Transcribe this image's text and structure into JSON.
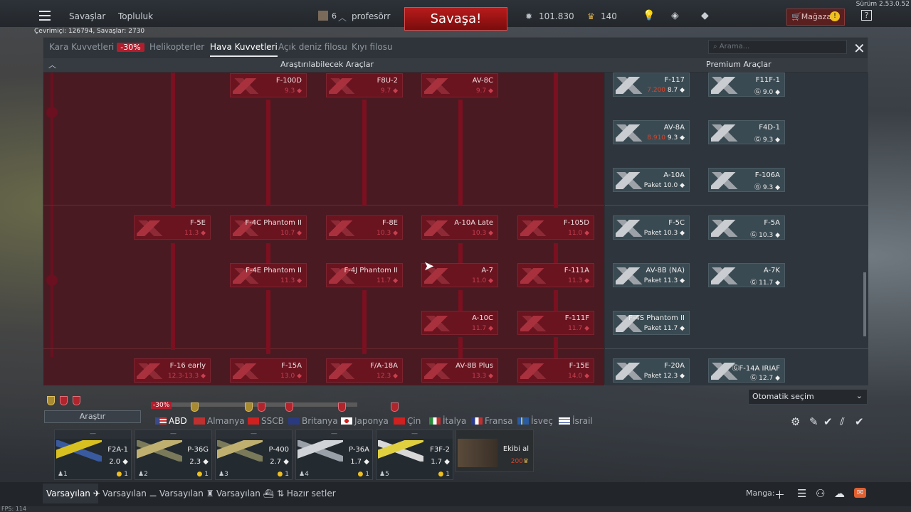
{
  "version": "Sürüm 2.53.0.52",
  "online": "Çevrimiçi: 126794, Savaşlar: 2730",
  "topbar": {
    "battles": "Savaşlar",
    "community": "Topluluk",
    "squad_count": "6",
    "player": "profesörr",
    "battle_button": "Savaşa!",
    "silver": "101.830",
    "gold": "140",
    "shop": "Mağaza"
  },
  "tabs": {
    "ground": "Kara Kuvvetleri",
    "ground_sale": "-30%",
    "heli": "Helikopterler",
    "air": "Hava Kuvvetleri",
    "bluewater": "Açık deniz filosu",
    "coastal": "Kıyı filosu"
  },
  "search": {
    "placeholder": "Arama..."
  },
  "headers": {
    "research": "Araştırılabilecek Araçlar",
    "premium": "Premium Araçlar"
  },
  "tree": [
    {
      "name": "F-100D",
      "br": "9.3 ◆"
    },
    {
      "name": "F8U-2",
      "br": "9.7 ◆"
    },
    {
      "name": "AV-8C",
      "br": "9.7 ◆"
    },
    {
      "name": "F-5E",
      "br": "11.3 ◆"
    },
    {
      "name": "F-4C Phantom II",
      "br": "10.7 ◆"
    },
    {
      "name": "F-8E",
      "br": "10.3 ◆"
    },
    {
      "name": "A-10A Late",
      "br": "10.3 ◆"
    },
    {
      "name": "F-105D",
      "br": "11.0 ◆"
    },
    {
      "name": "F-4E Phantom II",
      "br": "11.3 ◆"
    },
    {
      "name": "F-4J Phantom II",
      "br": "11.7 ◆"
    },
    {
      "name": "A-7",
      "br": "11.0 ◆"
    },
    {
      "name": "F-111A",
      "br": "11.3 ◆"
    },
    {
      "name": "A-10C",
      "br": "11.7 ◆"
    },
    {
      "name": "F-111F",
      "br": "11.7 ◆"
    },
    {
      "name": "F-16 early",
      "br": "12.3-13.3 ◆"
    },
    {
      "name": "F-15A",
      "br": "13.0 ◆"
    },
    {
      "name": "F/A-18A",
      "br": "12.3 ◆"
    },
    {
      "name": "AV-8B Plus",
      "br": "13.3 ◆"
    },
    {
      "name": "F-15E",
      "br": "14.0 ◆"
    }
  ],
  "premium": [
    {
      "name": "F-117",
      "price": "7.200",
      "br": "8.7 ◆"
    },
    {
      "name": "F11F-1",
      "price": "",
      "br": "9.0 ◆"
    },
    {
      "name": "AV-8A",
      "price": "8.910",
      "br": "9.3 ◆"
    },
    {
      "name": "F4D-1",
      "price": "",
      "br": "9.3 ◆"
    },
    {
      "name": "A-10A",
      "price": "Paket",
      "br": "10.0 ◆"
    },
    {
      "name": "F-106A",
      "price": "",
      "br": "9.3 ◆"
    },
    {
      "name": "F-5C",
      "price": "Paket",
      "br": "10.3 ◆"
    },
    {
      "name": "F-5A",
      "price": "",
      "br": "10.3 ◆"
    },
    {
      "name": "AV-8B (NA)",
      "price": "Paket",
      "br": "11.3 ◆"
    },
    {
      "name": "A-7K",
      "price": "",
      "br": "11.7 ◆"
    },
    {
      "name": "F-4S Phantom II",
      "price": "Paket",
      "br": "11.7 ◆"
    },
    {
      "name": "F-20A",
      "price": "Paket",
      "br": "12.3 ◆"
    },
    {
      "name": "F-14A IRIAF",
      "price": "",
      "br": "12.7 ◆"
    }
  ],
  "autoselect": "Otomatik seçim",
  "research_button": "Araştır",
  "nation_sale": "-30%",
  "nations": {
    "usa": "ABD",
    "germany": "Almanya",
    "ussr": "SSCB",
    "britain": "Britanya",
    "japan": "Japonya",
    "china": "Çin",
    "italy": "İtalya",
    "france": "Fransa",
    "sweden": "İsveç",
    "israel": "İsrail"
  },
  "slots": [
    {
      "dash": "—",
      "name": "F2A-1",
      "br": "2.0 ◆",
      "num": "1",
      "crew": "1"
    },
    {
      "dash": "—",
      "name": "P-36G",
      "br": "2.3 ◆",
      "num": "2",
      "crew": "1"
    },
    {
      "dash": "—",
      "name": "P-400",
      "br": "2.7 ◆",
      "num": "3",
      "crew": "1"
    },
    {
      "dash": "—",
      "name": "P-36A",
      "br": "1.7 ◆",
      "num": "4",
      "crew": "1"
    },
    {
      "dash": "—",
      "name": "F3F-2",
      "br": "1.7 ◆",
      "num": "5",
      "crew": "1"
    }
  ],
  "crew": {
    "label": "Ekibi al",
    "cost": "200"
  },
  "presets": {
    "air": "Varsayılan",
    "heli": "Varsayılan",
    "ground": "Varsayılan",
    "naval": "Varsayılan",
    "ready": "Hazır setler"
  },
  "squad": "Manga:",
  "fps": "FPS: 114"
}
